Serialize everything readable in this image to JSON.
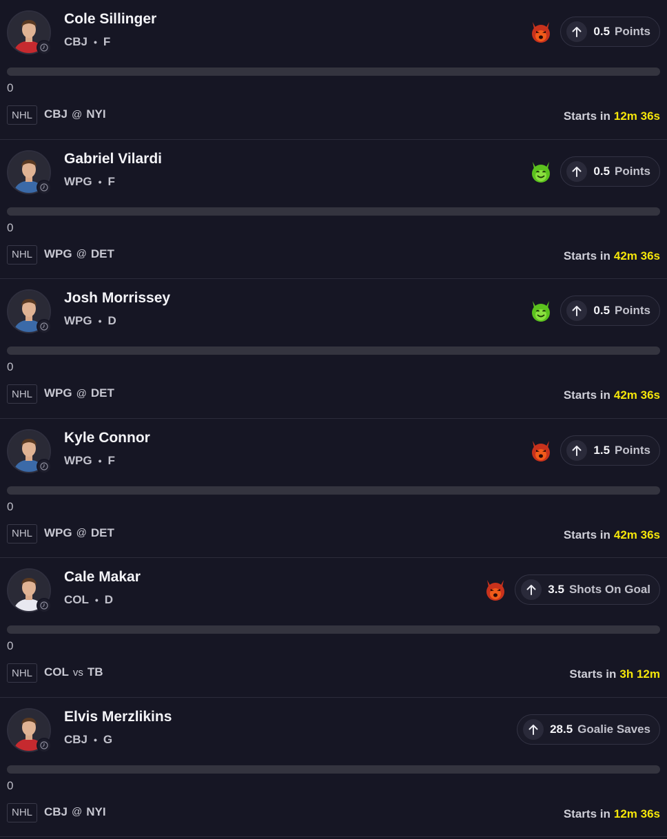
{
  "players": [
    {
      "name": "Cole Sillinger",
      "team": "CBJ",
      "position": "F",
      "demon": "red-demon-icon",
      "line": "0.5",
      "stat": "Points",
      "progress": 0,
      "count": "0",
      "league": "NHL",
      "home_team": "CBJ",
      "separator": "@",
      "away_team": "NYI",
      "starts_label": "Starts in",
      "starts_time": "12m 36s",
      "jersey_color": "#c62a2f"
    },
    {
      "name": "Gabriel Vilardi",
      "team": "WPG",
      "position": "F",
      "demon": "green-demon-icon",
      "line": "0.5",
      "stat": "Points",
      "progress": 0,
      "count": "0",
      "league": "NHL",
      "home_team": "WPG",
      "separator": "@",
      "away_team": "DET",
      "starts_label": "Starts in",
      "starts_time": "42m 36s",
      "jersey_color": "#3b6aa8"
    },
    {
      "name": "Josh Morrissey",
      "team": "WPG",
      "position": "D",
      "demon": "green-demon-icon",
      "line": "0.5",
      "stat": "Points",
      "progress": 0,
      "count": "0",
      "league": "NHL",
      "home_team": "WPG",
      "separator": "@",
      "away_team": "DET",
      "starts_label": "Starts in",
      "starts_time": "42m 36s",
      "jersey_color": "#3b6aa8"
    },
    {
      "name": "Kyle Connor",
      "team": "WPG",
      "position": "F",
      "demon": "red-demon-icon",
      "line": "1.5",
      "stat": "Points",
      "progress": 0,
      "count": "0",
      "league": "NHL",
      "home_team": "WPG",
      "separator": "@",
      "away_team": "DET",
      "starts_label": "Starts in",
      "starts_time": "42m 36s",
      "jersey_color": "#3b6aa8"
    },
    {
      "name": "Cale Makar",
      "team": "COL",
      "position": "D",
      "demon": "red-demon-icon",
      "line": "3.5",
      "stat": "Shots On Goal",
      "progress": 0,
      "count": "0",
      "league": "NHL",
      "home_team": "COL",
      "separator": "vs",
      "away_team": "TB",
      "starts_label": "Starts in",
      "starts_time": "3h 12m",
      "jersey_color": "#e8e8f0"
    },
    {
      "name": "Elvis Merzlikins",
      "team": "CBJ",
      "position": "G",
      "demon": "",
      "line": "28.5",
      "stat": "Goalie Saves",
      "progress": 0,
      "count": "0",
      "league": "NHL",
      "home_team": "CBJ",
      "separator": "@",
      "away_team": "NYI",
      "starts_label": "Starts in",
      "starts_time": "12m 36s",
      "jersey_color": "#c62a2f"
    }
  ],
  "colors": {
    "background": "#161624",
    "countdown": "#f5e60a",
    "red_demon": "#d22b1c",
    "green_demon": "#7ad12a"
  }
}
